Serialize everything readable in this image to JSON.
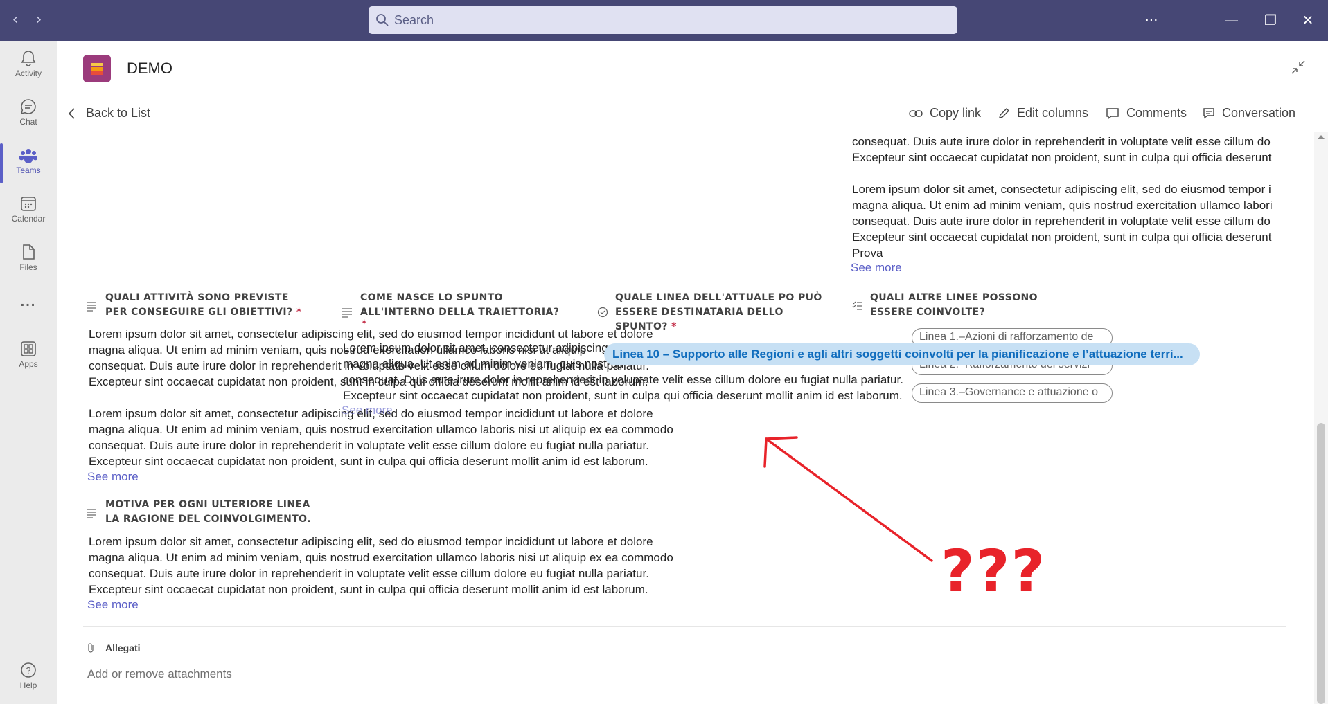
{
  "titlebar": {
    "back_icon": "chevron-left-icon",
    "forward_icon": "chevron-right-icon",
    "search_placeholder": "Search",
    "more_icon": "more-horizontal-icon",
    "minimize_icon": "minimize-icon",
    "restore_icon": "restore-icon",
    "close_icon": "close-icon"
  },
  "rail": {
    "items": [
      {
        "label": "Activity",
        "icon": "bell-icon"
      },
      {
        "label": "Chat",
        "icon": "chat-icon"
      },
      {
        "label": "Teams",
        "icon": "teams-icon",
        "active": true
      },
      {
        "label": "Calendar",
        "icon": "calendar-icon"
      },
      {
        "label": "Files",
        "icon": "file-icon"
      },
      {
        "label": "...",
        "icon": "more-horizontal-icon"
      },
      {
        "label": "Apps",
        "icon": "apps-icon"
      },
      {
        "label": "Help",
        "icon": "help-icon"
      }
    ]
  },
  "header": {
    "title": "DEMO"
  },
  "toolbar": {
    "back_label": "Back to List",
    "copy_link": "Copy link",
    "edit_columns": "Edit columns",
    "comments": "Comments",
    "conversation": "Conversation"
  },
  "top_right_block": {
    "lines": [
      "consequat. Duis aute irure dolor in reprehenderit in voluptate velit esse cillum do",
      "Excepteur sint occaecat cupidatat non proident, sunt in culpa qui officia deserunt",
      "",
      "Lorem ipsum dolor sit amet, consectetur adipiscing elit, sed do eiusmod tempor i",
      "magna aliqua. Ut enim ad minim veniam, quis nostrud exercitation ullamco labori",
      "consequat. Duis aute irure dolor in reprehenderit in voluptate velit esse cillum do",
      "Excepteur sint occaecat cupidatat non proident, sunt in culpa qui officia deserunt",
      "Prova"
    ],
    "see_more": "See more"
  },
  "fields": {
    "f1": {
      "title1": "QUALI ATTIVITÀ SONO PREVISTE",
      "title2": "PER CONSEGUIRE GLI OBIETTIVI?",
      "req": "*"
    },
    "f2": {
      "title1": "COME NASCE LO SPUNTO",
      "title2": "ALL'INTERNO DELLA TRAIETTORIA?",
      "req": "*"
    },
    "f3": {
      "title1": "QUALE LINEA DELL'ATTUALE PO PUÒ",
      "title2": "ESSERE DESTINATARIA DELLO",
      "title3": "SPUNTO?",
      "req": "*"
    },
    "f4": {
      "title1": "QUALI ALTRE LINEE POSSONO",
      "title2": "ESSERE COINVOLTE?"
    },
    "f5": {
      "title1": "MOTIVA PER OGNI ULTERIORE LINEA",
      "title2": "LA RAGIONE DEL COINVOLGIMENTO."
    }
  },
  "f1_text": {
    "p1": [
      "Lorem ipsum dolor sit amet, consectetur adipiscing elit, sed do eiusmod tempor incididunt ut labore et dolore",
      "magna aliqua. Ut enim ad minim veniam, quis nostrud exercitation ullamco laboris nisi ut aliquip",
      "consequat. Duis aute irure dolor in reprehenderit in voluptate velit esse cillum dolore eu fugiat nulla pariatur.",
      "Excepteur sint occaecat cupidatat non proident, sunt in culpa qui officia deserunt mollit anim id est laborum."
    ],
    "p2": [
      "Lorem ipsum dolor sit amet, consectetur adipiscing elit, sed do eiusmod tempor incididunt ut labore et dolore",
      "magna aliqua. Ut enim ad minim veniam, quis nostrud exercitation ullamco laboris nisi ut aliquip ex ea commodo",
      "consequat. Duis aute irure dolor in reprehenderit in voluptate velit esse cillum dolore eu fugiat nulla pariatur.",
      "Excepteur sint occaecat cupidatat non proident, sunt in culpa qui officia deserunt mollit anim id est laborum."
    ],
    "see_more": "See more"
  },
  "f2_text": {
    "lines": [
      "Lorem ipsum dolor sit amet, consectetur adipiscing",
      "magna aliqua. Ut enim ad minim veniam, quis nostrud",
      "consequat. Duis aute irure dolor in reprehenderit in voluptate velit esse cillum dolore eu fugiat nulla pariatur.",
      "Excepteur sint occaecat cupidatat non proident, sunt in culpa qui officia deserunt mollit anim id est laborum."
    ],
    "see_more": "See more"
  },
  "f4_chips": [
    "Linea 1.–Azioni di rafforzamento de",
    "Linea 2.–Rafforzamento dei servizi",
    "Linea 3.–Governance e attuazione o"
  ],
  "tooltip": "Linea 10 – Supporto alle Regioni e agli altri soggetti coinvolti per la pianificazione e l’attuazione terri...",
  "f5_text": {
    "lines": [
      "Lorem ipsum dolor sit amet, consectetur adipiscing elit, sed do eiusmod tempor incididunt ut labore et dolore",
      "magna aliqua. Ut enim ad minim veniam, quis nostrud exercitation ullamco laboris nisi ut aliquip ex ea commodo",
      "consequat. Duis aute irure dolor in reprehenderit in voluptate velit esse cillum dolore eu fugiat nulla pariatur.",
      "Excepteur sint occaecat cupidatat non proident, sunt in culpa qui officia deserunt mollit anim id est laborum."
    ],
    "see_more": "See more"
  },
  "attachments": {
    "title": "Allegati",
    "action": "Add or remove attachments"
  },
  "annotation": {
    "text": "???",
    "color": "#e8232a"
  },
  "colors": {
    "titlebar": "#464775",
    "accent": "#5b5fc7"
  }
}
